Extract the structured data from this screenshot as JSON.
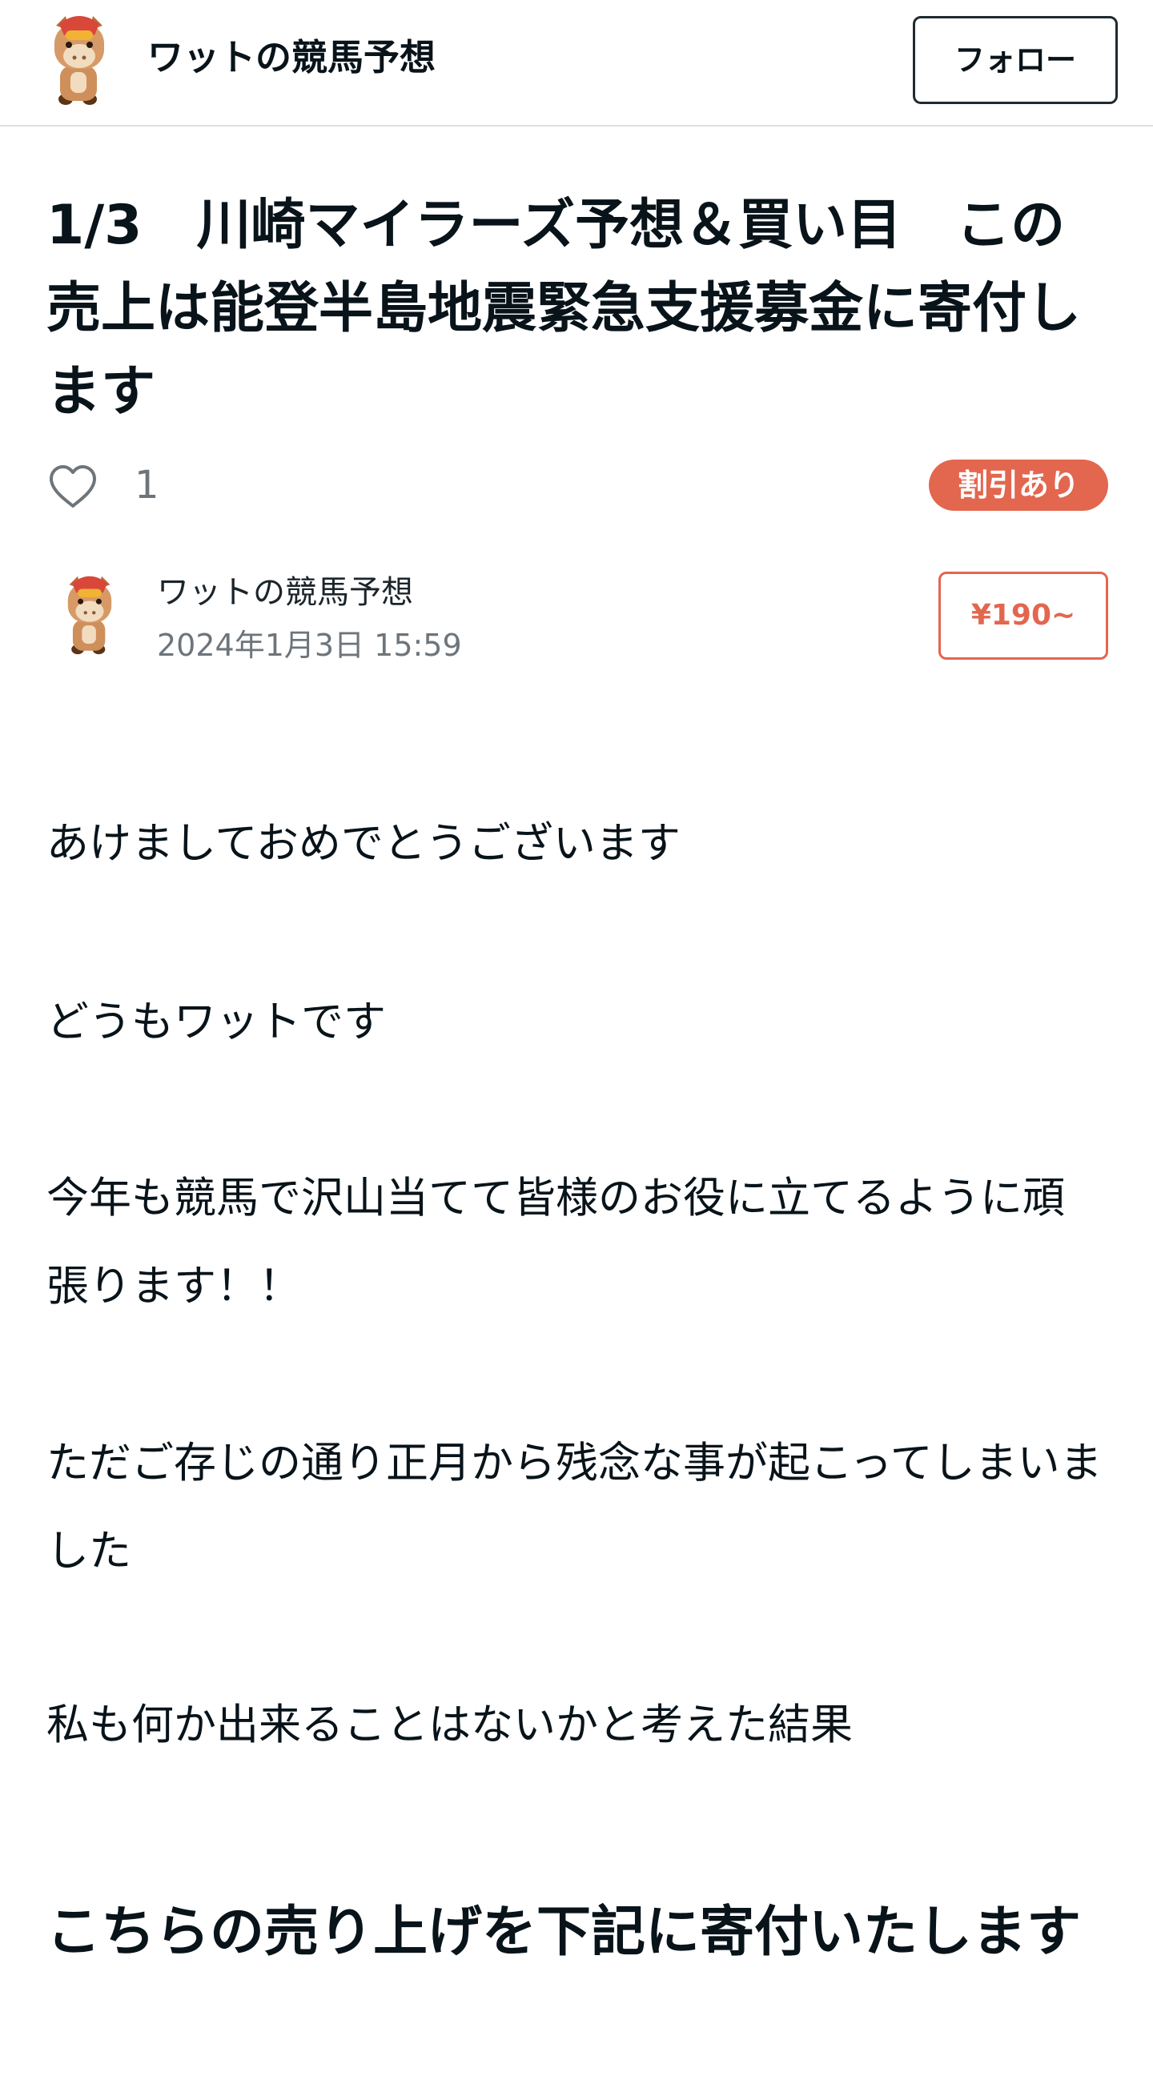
{
  "header": {
    "author_name": "ワットの競馬予想",
    "follow_label": "フォロー"
  },
  "article": {
    "title": "1/3　川崎マイラーズ予想＆買い目　この売上は能登半島地震緊急支援募金に寄付します",
    "likes": "1",
    "discount_badge": "割引あり",
    "author_name": "ワットの競馬予想",
    "date": "2024年1月3日 15:59",
    "price": "¥190~",
    "paragraphs": [
      "あけましておめでとうございます",
      "どうもワットです",
      "今年も競馬で沢山当てて皆様のお役に立てるように頑張ります！！",
      "ただご存じの通り正月から残念な事が起こってしまいました",
      "私も何か出来ることはないかと考えた結果"
    ],
    "heading": "こちらの売り上げを下記に寄付いたします"
  },
  "colors": {
    "accent": "#e3664f",
    "text": "#08131a",
    "muted": "#6d757b"
  },
  "icons": [
    "horse-avatar-icon",
    "heart-icon"
  ]
}
